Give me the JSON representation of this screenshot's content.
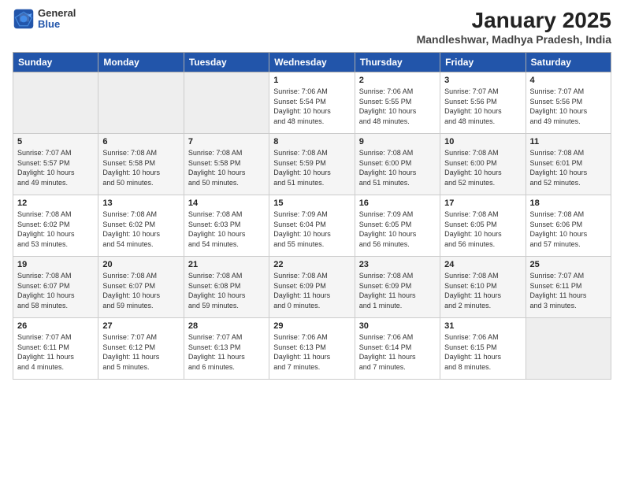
{
  "logo": {
    "general": "General",
    "blue": "Blue"
  },
  "header": {
    "title": "January 2025",
    "subtitle": "Mandleshwar, Madhya Pradesh, India"
  },
  "weekdays": [
    "Sunday",
    "Monday",
    "Tuesday",
    "Wednesday",
    "Thursday",
    "Friday",
    "Saturday"
  ],
  "weeks": [
    [
      {
        "day": "",
        "info": ""
      },
      {
        "day": "",
        "info": ""
      },
      {
        "day": "",
        "info": ""
      },
      {
        "day": "1",
        "info": "Sunrise: 7:06 AM\nSunset: 5:54 PM\nDaylight: 10 hours\nand 48 minutes."
      },
      {
        "day": "2",
        "info": "Sunrise: 7:06 AM\nSunset: 5:55 PM\nDaylight: 10 hours\nand 48 minutes."
      },
      {
        "day": "3",
        "info": "Sunrise: 7:07 AM\nSunset: 5:56 PM\nDaylight: 10 hours\nand 48 minutes."
      },
      {
        "day": "4",
        "info": "Sunrise: 7:07 AM\nSunset: 5:56 PM\nDaylight: 10 hours\nand 49 minutes."
      }
    ],
    [
      {
        "day": "5",
        "info": "Sunrise: 7:07 AM\nSunset: 5:57 PM\nDaylight: 10 hours\nand 49 minutes."
      },
      {
        "day": "6",
        "info": "Sunrise: 7:08 AM\nSunset: 5:58 PM\nDaylight: 10 hours\nand 50 minutes."
      },
      {
        "day": "7",
        "info": "Sunrise: 7:08 AM\nSunset: 5:58 PM\nDaylight: 10 hours\nand 50 minutes."
      },
      {
        "day": "8",
        "info": "Sunrise: 7:08 AM\nSunset: 5:59 PM\nDaylight: 10 hours\nand 51 minutes."
      },
      {
        "day": "9",
        "info": "Sunrise: 7:08 AM\nSunset: 6:00 PM\nDaylight: 10 hours\nand 51 minutes."
      },
      {
        "day": "10",
        "info": "Sunrise: 7:08 AM\nSunset: 6:00 PM\nDaylight: 10 hours\nand 52 minutes."
      },
      {
        "day": "11",
        "info": "Sunrise: 7:08 AM\nSunset: 6:01 PM\nDaylight: 10 hours\nand 52 minutes."
      }
    ],
    [
      {
        "day": "12",
        "info": "Sunrise: 7:08 AM\nSunset: 6:02 PM\nDaylight: 10 hours\nand 53 minutes."
      },
      {
        "day": "13",
        "info": "Sunrise: 7:08 AM\nSunset: 6:02 PM\nDaylight: 10 hours\nand 54 minutes."
      },
      {
        "day": "14",
        "info": "Sunrise: 7:08 AM\nSunset: 6:03 PM\nDaylight: 10 hours\nand 54 minutes."
      },
      {
        "day": "15",
        "info": "Sunrise: 7:09 AM\nSunset: 6:04 PM\nDaylight: 10 hours\nand 55 minutes."
      },
      {
        "day": "16",
        "info": "Sunrise: 7:09 AM\nSunset: 6:05 PM\nDaylight: 10 hours\nand 56 minutes."
      },
      {
        "day": "17",
        "info": "Sunrise: 7:08 AM\nSunset: 6:05 PM\nDaylight: 10 hours\nand 56 minutes."
      },
      {
        "day": "18",
        "info": "Sunrise: 7:08 AM\nSunset: 6:06 PM\nDaylight: 10 hours\nand 57 minutes."
      }
    ],
    [
      {
        "day": "19",
        "info": "Sunrise: 7:08 AM\nSunset: 6:07 PM\nDaylight: 10 hours\nand 58 minutes."
      },
      {
        "day": "20",
        "info": "Sunrise: 7:08 AM\nSunset: 6:07 PM\nDaylight: 10 hours\nand 59 minutes."
      },
      {
        "day": "21",
        "info": "Sunrise: 7:08 AM\nSunset: 6:08 PM\nDaylight: 10 hours\nand 59 minutes."
      },
      {
        "day": "22",
        "info": "Sunrise: 7:08 AM\nSunset: 6:09 PM\nDaylight: 11 hours\nand 0 minutes."
      },
      {
        "day": "23",
        "info": "Sunrise: 7:08 AM\nSunset: 6:09 PM\nDaylight: 11 hours\nand 1 minute."
      },
      {
        "day": "24",
        "info": "Sunrise: 7:08 AM\nSunset: 6:10 PM\nDaylight: 11 hours\nand 2 minutes."
      },
      {
        "day": "25",
        "info": "Sunrise: 7:07 AM\nSunset: 6:11 PM\nDaylight: 11 hours\nand 3 minutes."
      }
    ],
    [
      {
        "day": "26",
        "info": "Sunrise: 7:07 AM\nSunset: 6:11 PM\nDaylight: 11 hours\nand 4 minutes."
      },
      {
        "day": "27",
        "info": "Sunrise: 7:07 AM\nSunset: 6:12 PM\nDaylight: 11 hours\nand 5 minutes."
      },
      {
        "day": "28",
        "info": "Sunrise: 7:07 AM\nSunset: 6:13 PM\nDaylight: 11 hours\nand 6 minutes."
      },
      {
        "day": "29",
        "info": "Sunrise: 7:06 AM\nSunset: 6:13 PM\nDaylight: 11 hours\nand 7 minutes."
      },
      {
        "day": "30",
        "info": "Sunrise: 7:06 AM\nSunset: 6:14 PM\nDaylight: 11 hours\nand 7 minutes."
      },
      {
        "day": "31",
        "info": "Sunrise: 7:06 AM\nSunset: 6:15 PM\nDaylight: 11 hours\nand 8 minutes."
      },
      {
        "day": "",
        "info": ""
      }
    ]
  ]
}
